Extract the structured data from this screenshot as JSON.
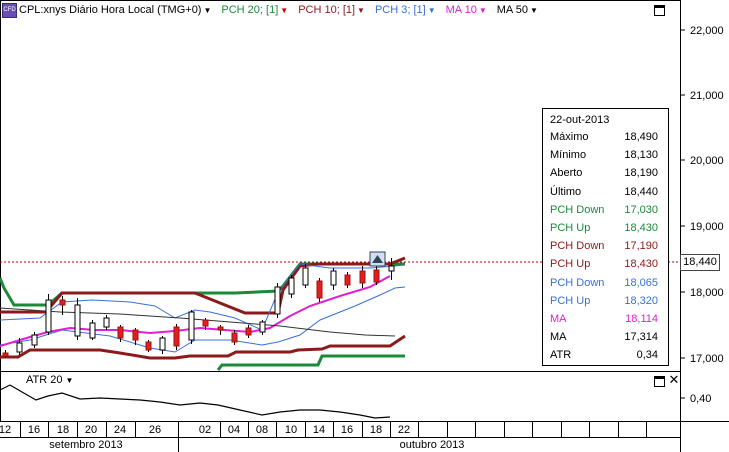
{
  "instrument_label": "CPL:xnys Diário Hora Local (TMG+0)",
  "legend": [
    {
      "label": "PCH 20; [1]",
      "color": "#1a8a3a"
    },
    {
      "label": "PCH 10; [1]",
      "color": "#8b1a1a"
    },
    {
      "label": "PCH 3; [1]",
      "color": "#3a6fd8"
    },
    {
      "label": "MA 10",
      "color": "#e020d0"
    },
    {
      "label": "MA 50",
      "color": "#000000"
    }
  ],
  "price_axis": [
    "22,000",
    "21,000",
    "20,000",
    "19,000",
    "18,000",
    "17,000"
  ],
  "atr_axis": [
    "0,40"
  ],
  "last_price": "18,440",
  "info": {
    "date": "22-out-2013",
    "rows": [
      {
        "key": "Máximo",
        "value": "18,490",
        "color": "#000000"
      },
      {
        "key": "Mínimo",
        "value": "18,130",
        "color": "#000000"
      },
      {
        "key": "Aberto",
        "value": "18,190",
        "color": "#000000"
      },
      {
        "key": "Último",
        "value": "18,440",
        "color": "#000000"
      },
      {
        "key": "PCH Down",
        "value": "17,030",
        "color": "#1a8a3a"
      },
      {
        "key": "PCH Up",
        "value": "18,430",
        "color": "#1a8a3a"
      },
      {
        "key": "PCH Down",
        "value": "17,190",
        "color": "#8b1a1a"
      },
      {
        "key": "PCH Up",
        "value": "18,430",
        "color": "#8b1a1a"
      },
      {
        "key": "PCH Down",
        "value": "18,065",
        "color": "#3a6fd8"
      },
      {
        "key": "PCH Up",
        "value": "18,320",
        "color": "#3a6fd8"
      },
      {
        "key": "MA",
        "value": "18,114",
        "color": "#e020d0"
      },
      {
        "key": "MA",
        "value": "17,314",
        "color": "#000000"
      },
      {
        "key": "ATR",
        "value": "0,34",
        "color": "#000000"
      }
    ]
  },
  "atr_label": "ATR 20",
  "date_axis": {
    "days": [
      "12",
      "16",
      "18",
      "20",
      "24",
      "26",
      "02",
      "04",
      "08",
      "10",
      "14",
      "16",
      "18",
      "22"
    ],
    "months": [
      "setembro 2013",
      "outubro 2013"
    ]
  },
  "colors": {
    "up_candle": "#ffffff",
    "down_candle": "#e02020",
    "last_price_line": "#c00000"
  }
}
